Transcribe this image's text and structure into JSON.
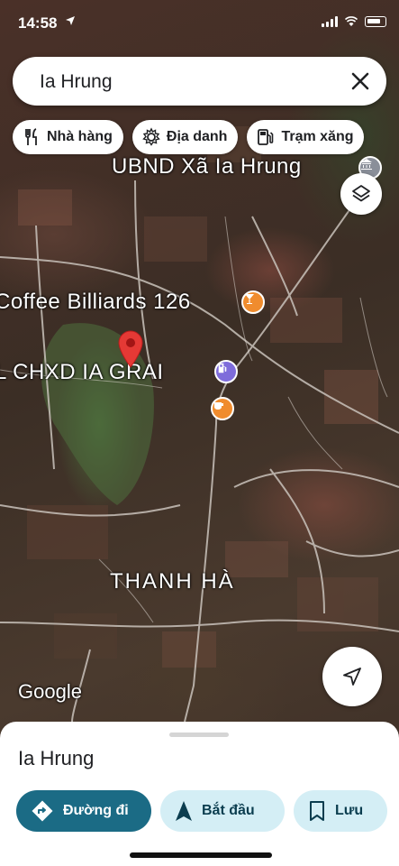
{
  "status_bar": {
    "time": "14:58"
  },
  "search": {
    "query": "Ia Hrung"
  },
  "chips": [
    {
      "label": "Nhà hàng",
      "icon": "restaurant-icon"
    },
    {
      "label": "Địa danh",
      "icon": "landmark-icon"
    },
    {
      "label": "Trạm xăng",
      "icon": "gas-station-icon"
    }
  ],
  "map": {
    "labels": {
      "ubnd": "UBND Xã Ia Hrung",
      "coffee": "Coffee Billiards 126",
      "chxd": "L CHXD IA GRAI",
      "thanh_ha": "THANH HÀ"
    },
    "attribution": "Google",
    "colors": {
      "pin": "#e53935",
      "cafe": "#f08c2e",
      "gas": "#7e6cdb",
      "gov": "#8a8f99"
    }
  },
  "sheet": {
    "place_name": "Ia Hrung",
    "actions": {
      "directions": "Đường đi",
      "start": "Bắt đầu",
      "save": "Lưu"
    }
  }
}
